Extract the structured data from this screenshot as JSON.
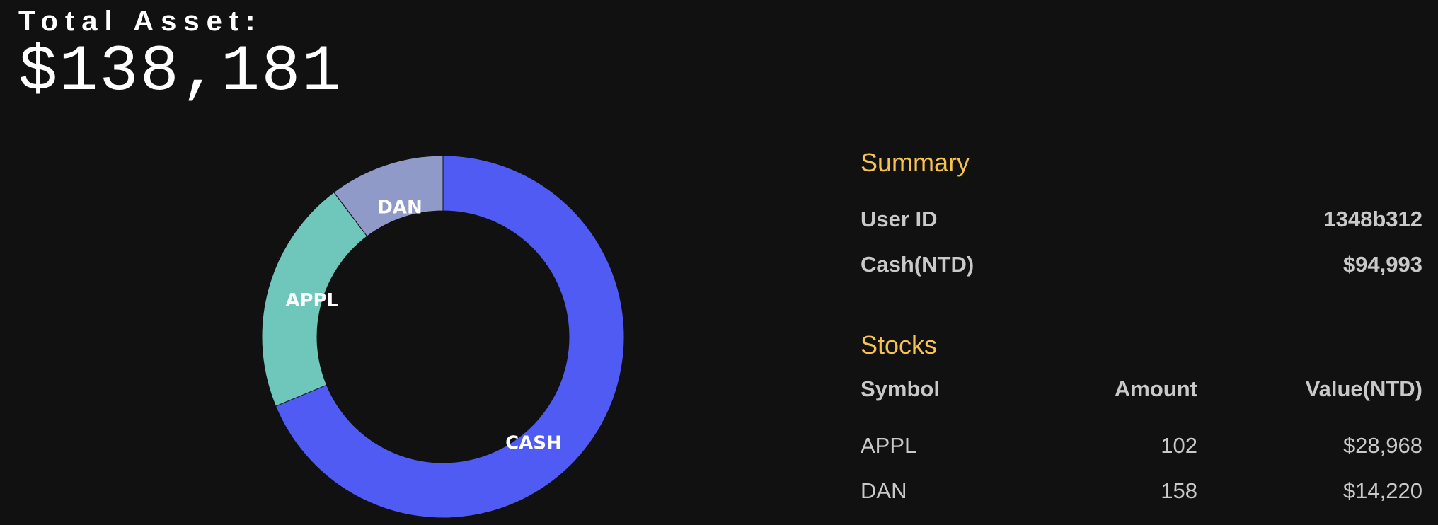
{
  "header": {
    "total_label": "Total Asset:",
    "total_value": "$138,181"
  },
  "chart_data": {
    "type": "pie",
    "categories": [
      "CASH",
      "APPL",
      "DAN"
    ],
    "values": [
      94993,
      28968,
      14220
    ],
    "colors": [
      "#4f5bf2",
      "#6fc7bc",
      "#8f9ac8"
    ],
    "labels": [
      "CASH",
      "APPL",
      "DAN"
    ]
  },
  "summary": {
    "title": "Summary",
    "user_id_label": "User ID",
    "user_id_value": "1348b312",
    "cash_label": "Cash(NTD)",
    "cash_value": "$94,993"
  },
  "stocks": {
    "title": "Stocks",
    "headers": [
      "Symbol",
      "Amount",
      "Value(NTD)"
    ],
    "rows": [
      {
        "symbol": "APPL",
        "amount": "102",
        "value": "$28,968"
      },
      {
        "symbol": "DAN",
        "amount": "158",
        "value": "$14,220"
      }
    ]
  },
  "colors": {
    "background": "#121111",
    "accent": "#f7c24e",
    "text": "#c9c9c9"
  }
}
